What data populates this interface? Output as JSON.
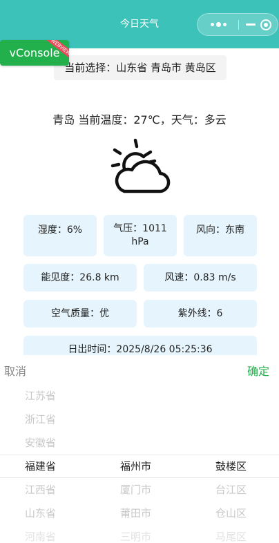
{
  "header": {
    "title": "今日天气"
  },
  "capsule": {
    "more_icon": "more-dots-icon",
    "minimize_icon": "minimize-icon",
    "close_icon": "target-close-icon"
  },
  "vconsole": {
    "label": "vConsole",
    "ribbon": "WEBVIEW"
  },
  "selection": {
    "text": "当前选择：山东省 青岛市 黄岛区"
  },
  "current": {
    "text": "青岛 当前温度：27℃，天气：多云"
  },
  "weather": {
    "icon": "partly-cloudy-icon",
    "condition": "多云"
  },
  "cards": {
    "humidity": "湿度：6%",
    "pressure_line1": "气压：1011",
    "pressure_line2": "hPa",
    "wind_direction": "风向：东南",
    "visibility": "能见度：26.8 km",
    "wind_speed": "风速：0.83 m/s",
    "air_quality": "空气质量：优",
    "uv": "紫外线：6",
    "sunrise": "日出时间：2025/8/26 05:25:36"
  },
  "picker": {
    "cancel": "取消",
    "confirm": "确定",
    "provinces": [
      "江苏省",
      "浙江省",
      "安徽省",
      "福建省",
      "江西省",
      "山东省",
      "河南省"
    ],
    "cities": [
      "福州市",
      "厦门市",
      "莆田市",
      "三明市"
    ],
    "districts": [
      "鼓楼区",
      "台江区",
      "仓山区",
      "马尾区"
    ]
  },
  "colors": {
    "header": "#3cc2b9",
    "card": "#e6f5fd",
    "confirm": "#22b04c",
    "vconsole": "#22b04c"
  }
}
